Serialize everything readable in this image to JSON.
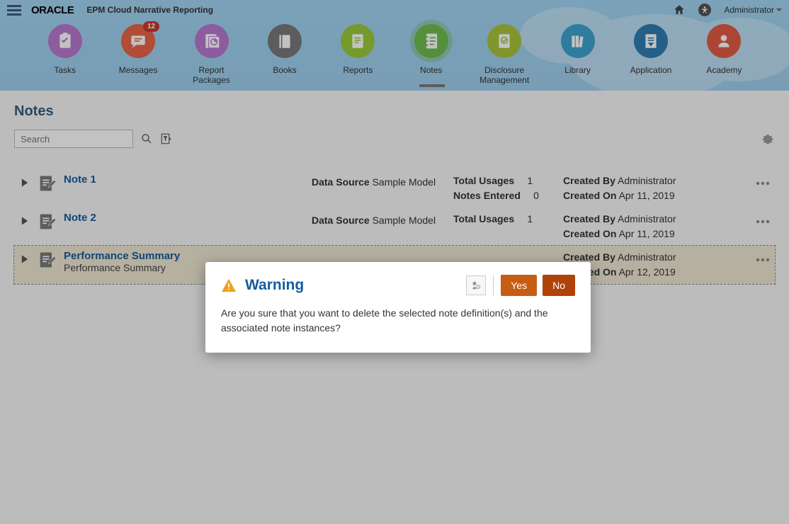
{
  "header": {
    "logo": "ORACLE",
    "appName": "EPM Cloud Narrative Reporting",
    "userLabel": "Administrator"
  },
  "nav": {
    "items": [
      {
        "label": "Tasks",
        "color": "#b97ad1"
      },
      {
        "label": "Messages",
        "color": "#e96448",
        "badge": "12"
      },
      {
        "label": "Report Packages",
        "color": "#b97ad1"
      },
      {
        "label": "Books",
        "color": "#7a7a7a"
      },
      {
        "label": "Reports",
        "color": "#9ccc3c"
      },
      {
        "label": "Notes",
        "color": "#6fbd4f",
        "active": true
      },
      {
        "label": "Disclosure\nManagement",
        "color": "#a9c53b"
      },
      {
        "label": "Library",
        "color": "#3fa3d1"
      },
      {
        "label": "Application",
        "color": "#2f7db5"
      },
      {
        "label": "Academy",
        "color": "#e35b45"
      }
    ]
  },
  "page": {
    "title": "Notes",
    "searchPlaceholder": "Search"
  },
  "labels": {
    "dataSource": "Data Source",
    "totalUsages": "Total Usages",
    "notesEntered": "Notes Entered",
    "createdBy": "Created By",
    "createdOn": "Created On"
  },
  "rows": [
    {
      "title": "Note 1",
      "subtitle": "",
      "dataSource": "Sample Model",
      "totalUsages": "1",
      "notesEntered": "0",
      "createdBy": "Administrator",
      "createdOn": "Apr 11, 2019"
    },
    {
      "title": "Note 2",
      "subtitle": "",
      "dataSource": "Sample Model",
      "totalUsages": "1",
      "notesEntered": "",
      "createdBy": "Administrator",
      "createdOn": "Apr 11, 2019"
    },
    {
      "title": "Performance Summary",
      "subtitle": "Performance Summary",
      "dataSource": "",
      "totalUsages": "",
      "notesEntered": "",
      "createdBy": "Administrator",
      "createdOn": "Apr 12, 2019",
      "selected": true
    }
  ],
  "dialog": {
    "title": "Warning",
    "body": "Are you sure that you want to delete the selected note definition(s) and the associated note instances?",
    "yes": "Yes",
    "no": "No"
  }
}
